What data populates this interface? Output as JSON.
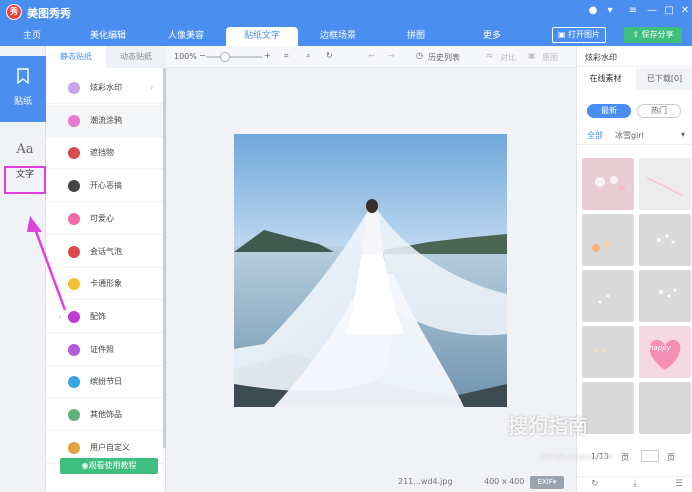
{
  "app": {
    "logo_text": "秀",
    "title": "美图秀秀"
  },
  "nav": {
    "tabs": [
      {
        "label": "主页"
      },
      {
        "label": "美化编辑"
      },
      {
        "label": "人像美容"
      },
      {
        "label": "贴纸文字"
      },
      {
        "label": "边框场景"
      },
      {
        "label": "拼图"
      },
      {
        "label": "更多"
      }
    ],
    "open_label": "打开图片",
    "save_label": "保存分享"
  },
  "left_rail": {
    "sticker_label": "贴纸",
    "text_label": "文字",
    "text_icon": "Aa"
  },
  "categories": {
    "tabs": [
      "静态贴纸",
      "动态贴纸"
    ],
    "items": [
      {
        "label": "炫彩水印",
        "color": "#c9a2e8"
      },
      {
        "label": "潮流涂鸦",
        "color": "#e67ad0"
      },
      {
        "label": "遮挡物",
        "color": "#d94a4a"
      },
      {
        "label": "开心恶搞",
        "color": "#444444"
      },
      {
        "label": "可爱心",
        "color": "#f06aa9"
      },
      {
        "label": "会话气泡",
        "color": "#e04848"
      },
      {
        "label": "卡通形象",
        "color": "#f2c12e"
      },
      {
        "label": "配饰",
        "color": "#c03cd0"
      },
      {
        "label": "证件照",
        "color": "#b45ad6"
      },
      {
        "label": "缤纷节日",
        "color": "#3aa6e0"
      },
      {
        "label": "其他饰品",
        "color": "#5fb37a"
      },
      {
        "label": "用户自定义",
        "color": "#e3a43c"
      }
    ],
    "tutorial_label": "观看使用教程"
  },
  "toolbar": {
    "zoom": "100%",
    "history_label": "历史列表",
    "compare_label": "对比",
    "original_label": "原图"
  },
  "status": {
    "filename": "211...wd4.jpg",
    "dimensions": "400 x 400",
    "exif_label": "EXIF"
  },
  "right_panel": {
    "title": "炫彩水印",
    "subtabs": [
      "在线素材",
      "已下载[0]"
    ],
    "pills": [
      "最新",
      "热门"
    ],
    "filters": [
      "全部",
      "冰雪girl"
    ],
    "page_text": "1/13",
    "page_suffix": "页",
    "thumb_caption": "happy"
  },
  "watermark": {
    "text": "搜狗指南",
    "url": "zhinan.sogou.com"
  },
  "colors": {
    "accent": "#4a8ef0",
    "highlight": "#e040e0",
    "green": "#3fbf7f"
  }
}
